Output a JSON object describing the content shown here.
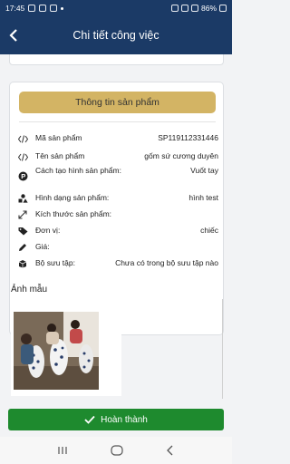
{
  "status_bar": {
    "time": "17:45",
    "battery": "86%"
  },
  "appbar": {
    "title": "Chi tiết công việc",
    "back_icon": "chevron-left-icon"
  },
  "card": {
    "header_button": "Thông tin sản phẩm",
    "rows": [
      {
        "label": "Mã sản phẩm",
        "value": "SP119112331446",
        "icon": "code-icon"
      },
      {
        "label": "Tên sản phẩm",
        "value": "gốm sứ cương duyên",
        "icon": "code-icon"
      },
      {
        "label": "Cách tạo hình sản phẩm:",
        "value": "Vuốt tay",
        "icon": "p-circle-icon"
      },
      {
        "label": "Hình dạng sản phẩm:",
        "value": "hình test",
        "icon": "shapes-icon"
      },
      {
        "label": "Kích thước sản phẩm:",
        "value": "",
        "icon": "resize-icon"
      },
      {
        "label": "Đơn vị:",
        "value": "chiếc",
        "icon": "tag-icon"
      },
      {
        "label": "Giá:",
        "value": "",
        "icon": "pencil-icon"
      },
      {
        "label": "Bộ sưu tập:",
        "value": "Chưa có trong bộ sưu tập nào",
        "icon": "box-icon"
      }
    ]
  },
  "images": {
    "title": "Ảnh mẫu"
  },
  "footer": {
    "done_label": "Hoàn thành"
  },
  "colors": {
    "appbar": "#1b3a66",
    "gold": "#d3b464",
    "green": "#1e8a2e"
  }
}
